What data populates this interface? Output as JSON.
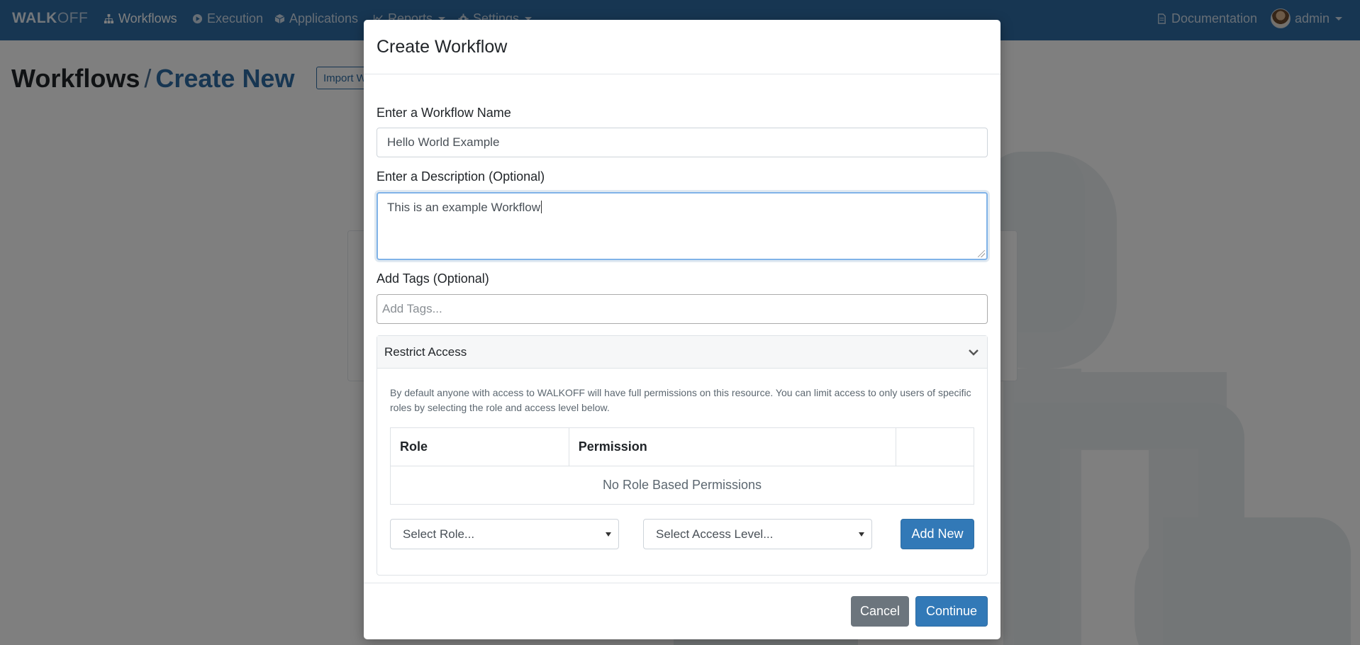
{
  "colors": {
    "navbar": "#2e6da4",
    "primary": "#3279b7",
    "secondary": "#6c757d",
    "overlay": "rgba(0,0,0,0.5)"
  },
  "navbar": {
    "brand_bold": "WALK",
    "brand_light": "OFF",
    "items": [
      {
        "label": "Workflows",
        "icon": "sitemap-icon",
        "active": true
      },
      {
        "label": "Execution",
        "icon": "play-circle-icon"
      },
      {
        "label": "Applications",
        "icon": "cube-icon"
      },
      {
        "label": "Reports",
        "icon": "chart-icon",
        "dropdown": true
      },
      {
        "label": "Settings",
        "icon": "gear-icon",
        "dropdown": true
      }
    ],
    "documentation": "Documentation",
    "user": "admin"
  },
  "page": {
    "title": "Workflows",
    "separator": "/",
    "subtitle": "Create New",
    "import_button": "Import Workflow"
  },
  "modal": {
    "title": "Create Workflow",
    "name_label": "Enter a Workflow Name",
    "name_value": "Hello World Example",
    "description_label": "Enter a Description (Optional)",
    "description_value": "This is an example Workflow",
    "tags_label": "Add Tags (Optional)",
    "tags_placeholder": "Add Tags...",
    "restrict_access": {
      "header": "Restrict Access",
      "note": "By default anyone with access to WALKOFF will have full permissions on this resource. You can limit access to only users of specific roles by selecting the role and access level below.",
      "columns": [
        "Role",
        "Permission",
        ""
      ],
      "empty_message": "No Role Based Permissions",
      "role_select": "Select Role...",
      "access_select": "Select Access Level...",
      "add_button": "Add New"
    },
    "cancel_button": "Cancel",
    "continue_button": "Continue"
  }
}
